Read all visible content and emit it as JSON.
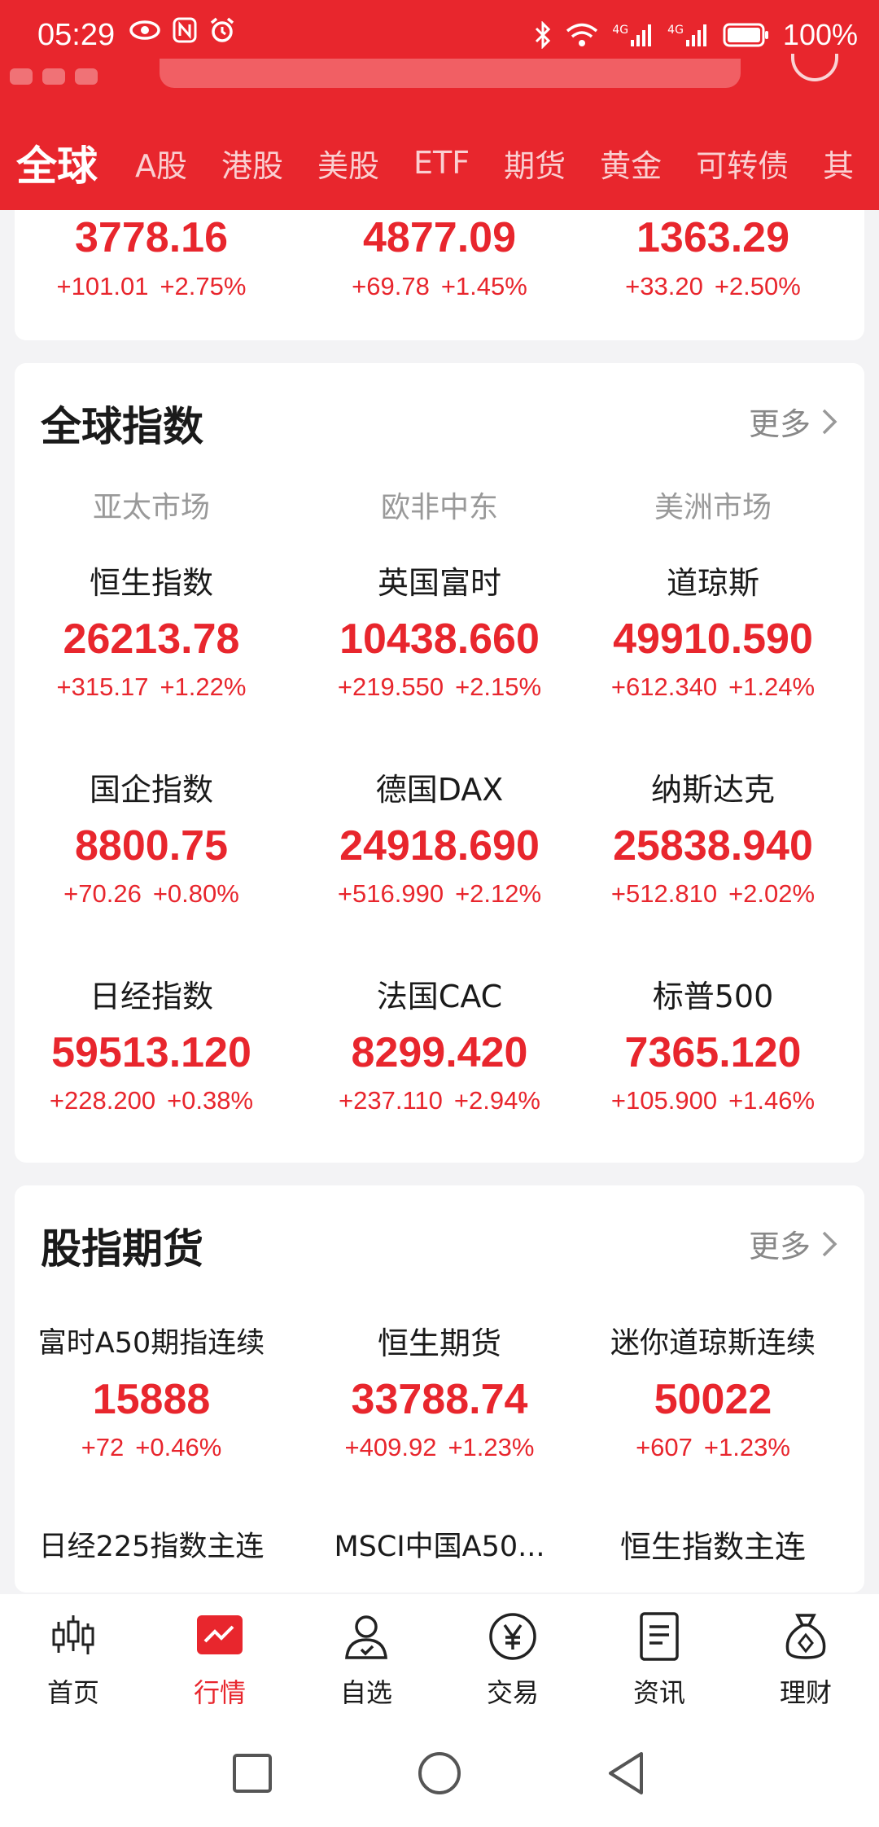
{
  "status_bar": {
    "time": "05:29",
    "battery": "100%",
    "network_1": "4G",
    "network_2": "4G"
  },
  "tabs": [
    "全球",
    "A股",
    "港股",
    "美股",
    "ETF",
    "期货",
    "黄金",
    "可转债",
    "其"
  ],
  "top_indices": [
    {
      "value": "3778.16",
      "change": "+101.01",
      "pct": "+2.75%"
    },
    {
      "value": "4877.09",
      "change": "+69.78",
      "pct": "+1.45%"
    },
    {
      "value": "1363.29",
      "change": "+33.20",
      "pct": "+2.50%"
    }
  ],
  "global": {
    "title": "全球指数",
    "more": "更多",
    "columns": [
      "亚太市场",
      "欧非中东",
      "美洲市场"
    ],
    "rows": [
      [
        {
          "name": "恒生指数",
          "value": "26213.78",
          "change": "+315.17",
          "pct": "+1.22%"
        },
        {
          "name": "英国富时",
          "value": "10438.660",
          "change": "+219.550",
          "pct": "+2.15%"
        },
        {
          "name": "道琼斯",
          "value": "49910.590",
          "change": "+612.340",
          "pct": "+1.24%"
        }
      ],
      [
        {
          "name": "国企指数",
          "value": "8800.75",
          "change": "+70.26",
          "pct": "+0.80%"
        },
        {
          "name": "德国DAX",
          "value": "24918.690",
          "change": "+516.990",
          "pct": "+2.12%"
        },
        {
          "name": "纳斯达克",
          "value": "25838.940",
          "change": "+512.810",
          "pct": "+2.02%"
        }
      ],
      [
        {
          "name": "日经指数",
          "value": "59513.120",
          "change": "+228.200",
          "pct": "+0.38%"
        },
        {
          "name": "法国CAC",
          "value": "8299.420",
          "change": "+237.110",
          "pct": "+2.94%"
        },
        {
          "name": "标普500",
          "value": "7365.120",
          "change": "+105.900",
          "pct": "+1.46%"
        }
      ]
    ]
  },
  "futures": {
    "title": "股指期货",
    "more": "更多",
    "rows": [
      [
        {
          "name": "富时A50期指连续",
          "value": "15888",
          "change": "+72",
          "pct": "+0.46%"
        },
        {
          "name": "恒生期货",
          "value": "33788.74",
          "change": "+409.92",
          "pct": "+1.23%"
        },
        {
          "name": "迷你道琼斯连续",
          "value": "50022",
          "change": "+607",
          "pct": "+1.23%"
        }
      ],
      [
        {
          "name": "日经225指数主连"
        },
        {
          "name": "MSCI中国A50..."
        },
        {
          "name": "恒生指数主连"
        }
      ]
    ]
  },
  "bottom_nav": [
    {
      "label": "首页",
      "icon": "candlestick-icon"
    },
    {
      "label": "行情",
      "icon": "market-chart-icon"
    },
    {
      "label": "自选",
      "icon": "watchlist-person-icon"
    },
    {
      "label": "交易",
      "icon": "yuan-coin-icon"
    },
    {
      "label": "资讯",
      "icon": "news-document-icon"
    },
    {
      "label": "理财",
      "icon": "money-bag-icon"
    }
  ],
  "colors": {
    "brand_red": "#e8262d",
    "up": "#e8262d",
    "background": "#f3f3f5"
  }
}
